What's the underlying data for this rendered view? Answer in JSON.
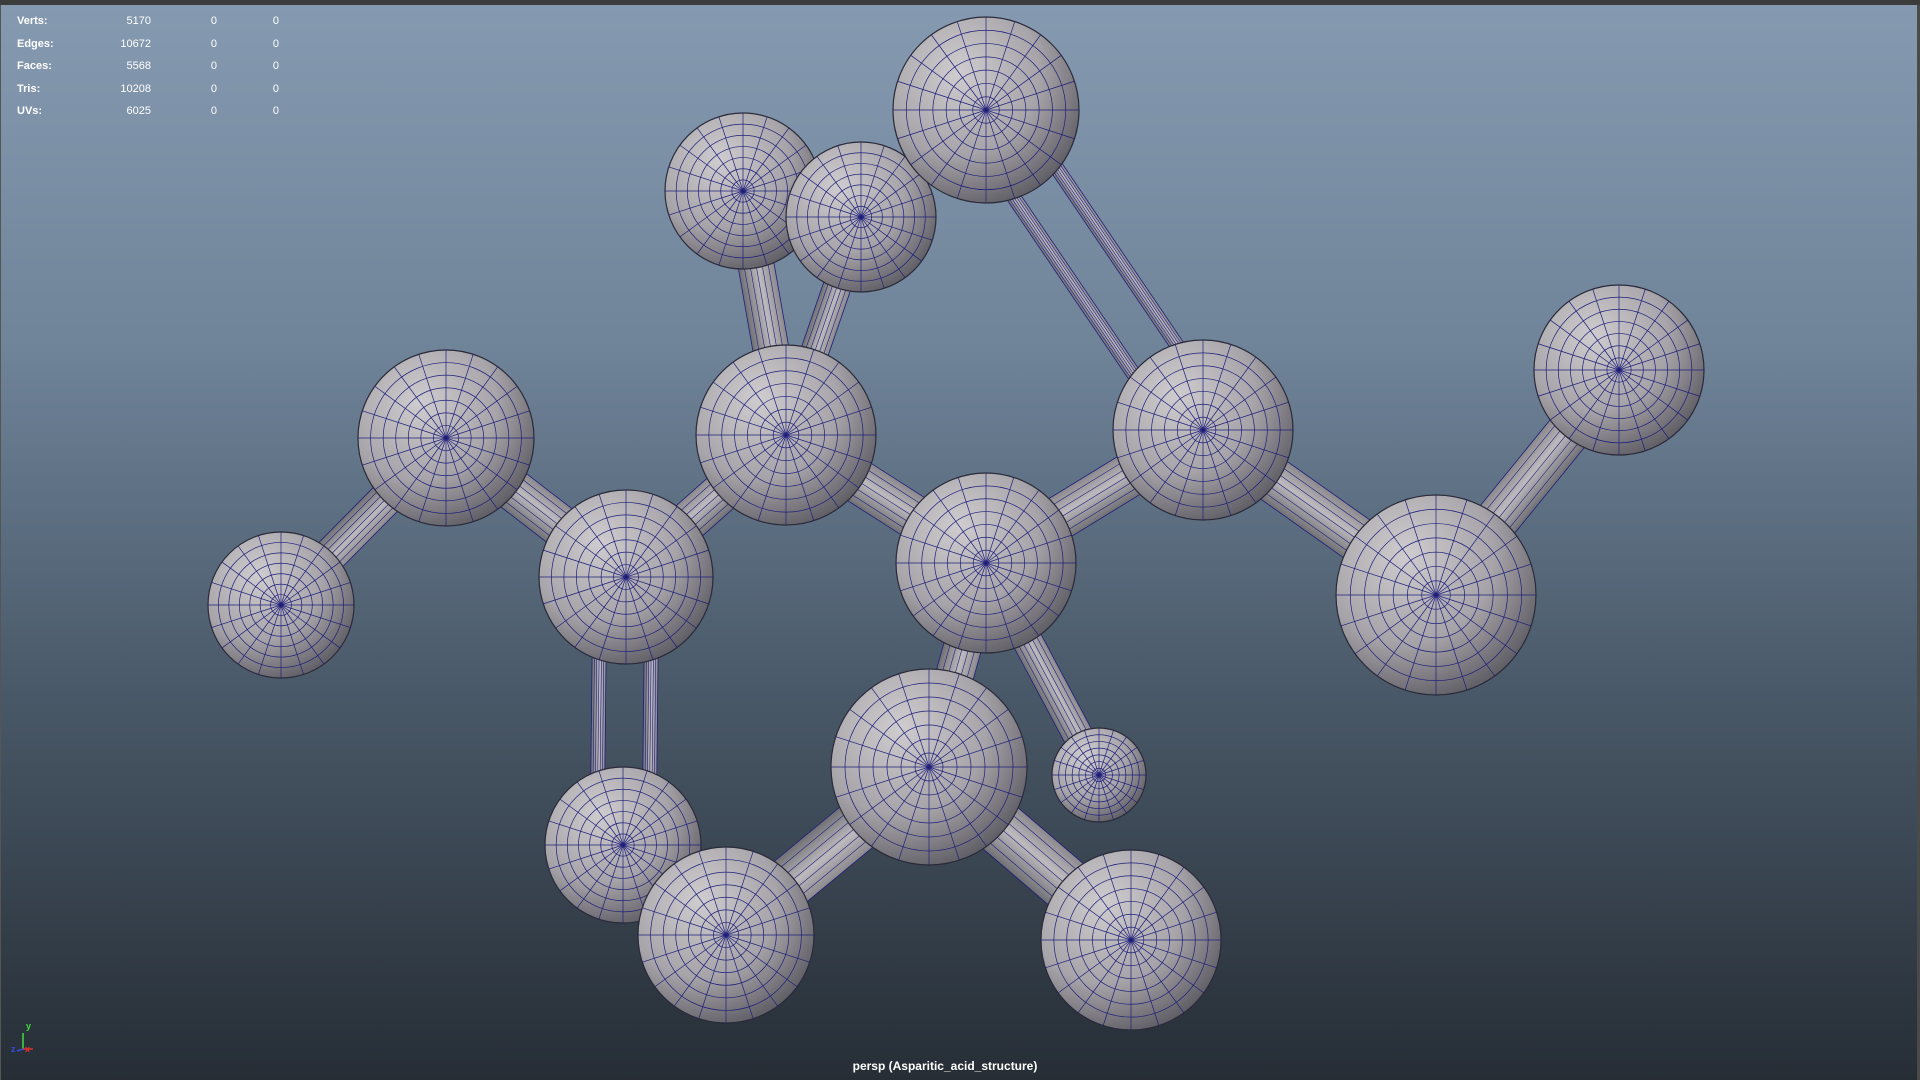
{
  "viewport": {
    "camera_label": "persp (Asparitic_acid_structure)"
  },
  "hud": {
    "rows": [
      {
        "label": "Verts:",
        "total": "5170",
        "selected": "0",
        "component": "0"
      },
      {
        "label": "Edges:",
        "total": "10672",
        "selected": "0",
        "component": "0"
      },
      {
        "label": "Faces:",
        "total": "5568",
        "selected": "0",
        "component": "0"
      },
      {
        "label": "Tris:",
        "total": "10208",
        "selected": "0",
        "component": "0"
      },
      {
        "label": "UVs:",
        "total": "6025",
        "selected": "0",
        "component": "0"
      }
    ]
  },
  "axis_gizmo": {
    "y_label": "y",
    "x_label": "x",
    "z_label": "z"
  },
  "colors": {
    "wireframe": "#1e1e7a",
    "sphere_light": "#c9c6ca",
    "sphere_dark": "#545257",
    "viewport_top": "#8599b0",
    "viewport_bottom": "#262d35"
  }
}
